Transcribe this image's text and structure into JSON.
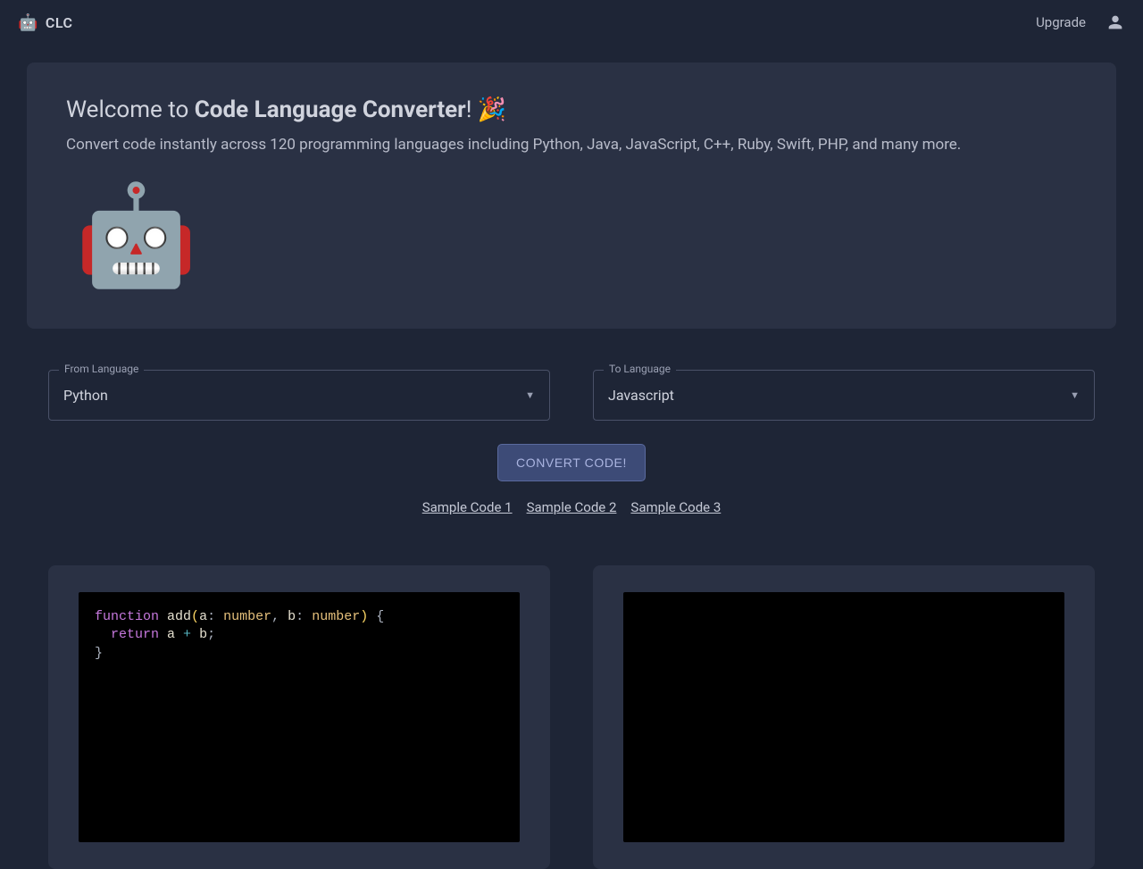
{
  "header": {
    "brand": "CLC",
    "brand_icon": "🤖",
    "upgrade": "Upgrade"
  },
  "welcome": {
    "prefix": "Welcome to ",
    "title": "Code Language Converter",
    "suffix": "! 🎉",
    "subtitle": "Convert code instantly across 120 programming languages including Python, Java, JavaScript, C++, Ruby, Swift, PHP, and many more.",
    "robot": "🤖"
  },
  "selects": {
    "from_label": "From Language",
    "from_value": "Python",
    "to_label": "To Language",
    "to_value": "Javascript"
  },
  "actions": {
    "convert": "CONVERT CODE!",
    "samples": [
      "Sample Code 1",
      "Sample Code 2",
      "Sample Code 3"
    ]
  },
  "code": {
    "source_tokens": [
      {
        "t": "function",
        "c": "kw"
      },
      {
        "t": " ",
        "c": ""
      },
      {
        "t": "add",
        "c": "fn"
      },
      {
        "t": "(",
        "c": "paren"
      },
      {
        "t": "a",
        "c": "param"
      },
      {
        "t": ":",
        "c": "punct"
      },
      {
        "t": " ",
        "c": ""
      },
      {
        "t": "number",
        "c": "type"
      },
      {
        "t": ",",
        "c": "punct"
      },
      {
        "t": " ",
        "c": ""
      },
      {
        "t": "b",
        "c": "param"
      },
      {
        "t": ":",
        "c": "punct"
      },
      {
        "t": " ",
        "c": ""
      },
      {
        "t": "number",
        "c": "type"
      },
      {
        "t": ")",
        "c": "paren"
      },
      {
        "t": " ",
        "c": ""
      },
      {
        "t": "{",
        "c": "brace"
      },
      {
        "t": "\n  ",
        "c": ""
      },
      {
        "t": "return",
        "c": "return"
      },
      {
        "t": " a ",
        "c": "param"
      },
      {
        "t": "+",
        "c": "op"
      },
      {
        "t": " b",
        "c": "param"
      },
      {
        "t": ";",
        "c": "punct"
      },
      {
        "t": "\n",
        "c": ""
      },
      {
        "t": "}",
        "c": "brace"
      }
    ],
    "target_text": ""
  }
}
